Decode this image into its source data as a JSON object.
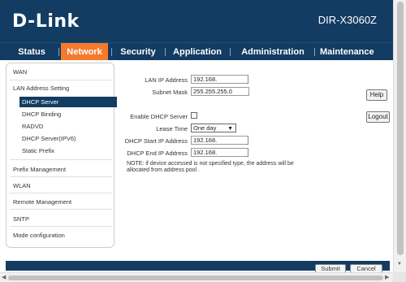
{
  "header": {
    "brand": "D-Link",
    "model": "DIR-X3060Z"
  },
  "nav": {
    "items": [
      {
        "label": "Status",
        "active": false
      },
      {
        "label": "Network",
        "active": true
      },
      {
        "label": "Security",
        "active": false
      },
      {
        "label": "Application",
        "active": false
      },
      {
        "label": "Administration",
        "active": false
      },
      {
        "label": "Maintenance",
        "active": false
      }
    ]
  },
  "sidebar": {
    "wan": "WAN",
    "lan_setting": "LAN Address Setting",
    "sub": [
      "DHCP Server",
      "DHCP Binding",
      "RADVD",
      "DHCP Server(IPV6)",
      "Static Prefix"
    ],
    "active_sub": "DHCP Server",
    "prefix": "Prefix Management",
    "wlan": "WLAN",
    "remote": "Remote Management",
    "sntp": "SNTP",
    "mode": "Mode configuration"
  },
  "form": {
    "lan_ip_label": "LAN IP Address",
    "lan_ip_value": "192.168.",
    "subnet_label": "Subnet Mask",
    "subnet_value": "255.255.255.0",
    "enable_dhcp_label": "Enable DHCP Server",
    "enable_dhcp_checked": false,
    "lease_label": "Lease Time",
    "lease_value": "One day",
    "start_ip_label": "DHCP Start IP Address",
    "start_ip_value": "192.168.",
    "end_ip_label": "DHCP End IP Address",
    "end_ip_value": "192.168.",
    "note_line1": "NOTE:  if device accessed is not specified type, the address will be",
    "note_line2": "allocated from address pool ."
  },
  "buttons": {
    "help": "Help",
    "logout": "Logout",
    "submit": "Submit",
    "cancel": "Cancel"
  },
  "colors": {
    "header_bg": "#123c62",
    "nav_active": "#f57a2b"
  }
}
